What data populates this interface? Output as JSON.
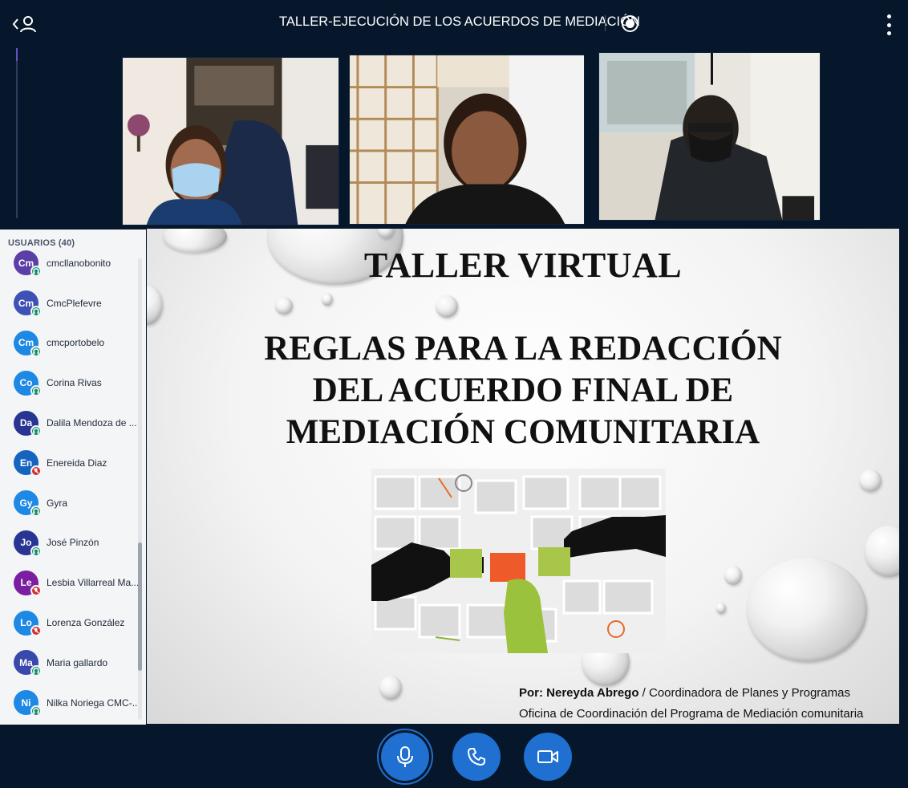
{
  "header": {
    "title": "TALLER-EJECUCIÓN DE LOS ACUERDOS DE MEDIACIÓN",
    "back_icon": "chevron-left-icon",
    "users_toggle_icon": "user-icon",
    "record_icon": "record-icon",
    "menu_icon": "more-vertical-icon"
  },
  "users_panel": {
    "header": "USUARIOS (40)",
    "users": [
      {
        "initials": "Cm",
        "name": "cmcllanobonito",
        "color": "#5b3fa6",
        "status": "listen-only"
      },
      {
        "initials": "Cm",
        "name": "CmcPlefevre",
        "color": "#3f51b5",
        "status": "listen-only"
      },
      {
        "initials": "Cm",
        "name": "cmcportobelo",
        "color": "#1e88e5",
        "status": "listen-only"
      },
      {
        "initials": "Co",
        "name": "Corina Rivas",
        "color": "#1e88e5",
        "status": "listen-only"
      },
      {
        "initials": "Da",
        "name": "Dalila Mendoza de ...",
        "color": "#283593",
        "status": "listen-only"
      },
      {
        "initials": "En",
        "name": "Enereida Diaz",
        "color": "#1565c0",
        "status": "muted"
      },
      {
        "initials": "Gy",
        "name": "Gyra",
        "color": "#1e88e5",
        "status": "listen-only"
      },
      {
        "initials": "Jo",
        "name": "José Pinzón",
        "color": "#283593",
        "status": "listen-only"
      },
      {
        "initials": "Le",
        "name": "Lesbia Villarreal Ma...",
        "color": "#7b1fa2",
        "status": "muted"
      },
      {
        "initials": "Lo",
        "name": "Lorenza González",
        "color": "#1e88e5",
        "status": "muted"
      },
      {
        "initials": "Ma",
        "name": "Maria gallardo",
        "color": "#3949ab",
        "status": "listen-only"
      },
      {
        "initials": "Ni",
        "name": "Nilka Noriega CMC-...",
        "color": "#1e88e5",
        "status": "listen-only"
      }
    ]
  },
  "slide": {
    "title": "TALLER VIRTUAL",
    "subtitle_line1": "REGLAS PARA LA REDACCIÓN",
    "subtitle_line2": "DEL  ACUERDO FINAL DE",
    "subtitle_line3": "MEDIACIÓN COMUNITARIA",
    "author_prefix": "Por:",
    "author_name": "Nereyda Abrego",
    "author_role": " / Coordinadora de Planes y Programas",
    "office": "Oficina de Coordinación del Programa de Mediación comunitaria"
  },
  "controls": {
    "mic_icon": "microphone-icon",
    "phone_icon": "phone-icon",
    "camera_icon": "camera-icon"
  },
  "colors": {
    "background": "#06172b",
    "accent": "#1f70d1",
    "listen_badge": "#0f8a6e",
    "muted_badge": "#d32f2f"
  }
}
